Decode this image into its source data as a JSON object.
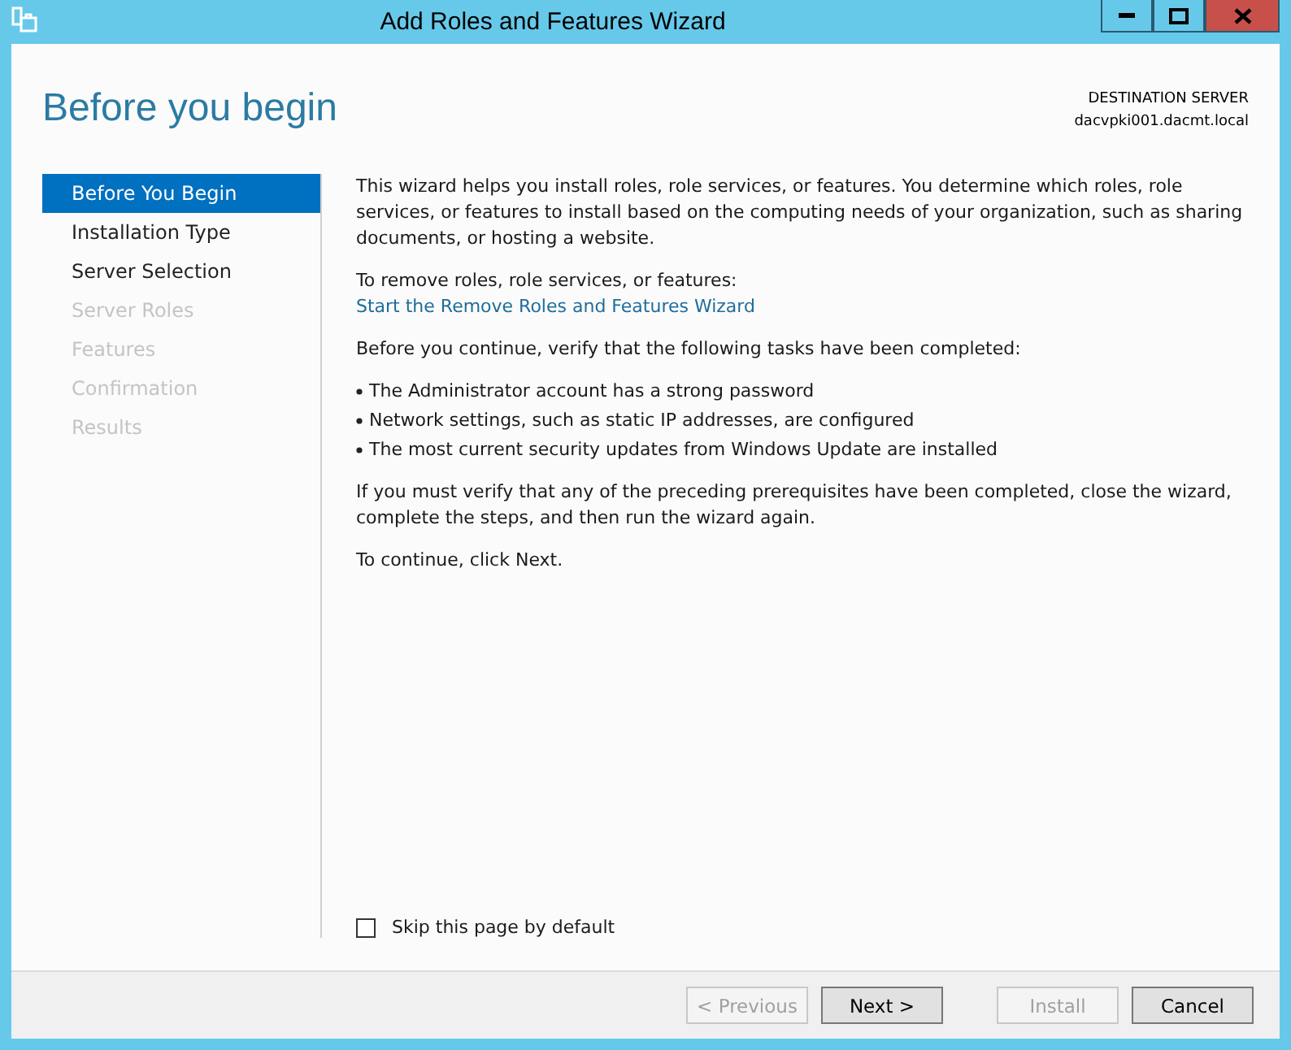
{
  "window": {
    "title": "Add Roles and Features Wizard"
  },
  "page_title": "Before you begin",
  "destination": {
    "label": "DESTINATION SERVER",
    "server": "dacvpki001.dacmt.local"
  },
  "steps": [
    {
      "label": "Before You Begin",
      "selected": true,
      "disabled": false
    },
    {
      "label": "Installation Type",
      "selected": false,
      "disabled": false
    },
    {
      "label": "Server Selection",
      "selected": false,
      "disabled": false
    },
    {
      "label": "Server Roles",
      "selected": false,
      "disabled": true
    },
    {
      "label": "Features",
      "selected": false,
      "disabled": true
    },
    {
      "label": "Confirmation",
      "selected": false,
      "disabled": true
    },
    {
      "label": "Results",
      "selected": false,
      "disabled": true
    }
  ],
  "intro": "This wizard helps you install roles, role services, or features. You determine which roles, role services, or features to install based on the computing needs of your organization, such as sharing documents, or hosting a website.",
  "remove_label": "To remove roles, role services, or features:",
  "remove_link": "Start the Remove Roles and Features Wizard",
  "verify_text": "Before you continue, verify that the following tasks have been completed:",
  "tasks": [
    "The Administrator account has a strong password",
    "Network settings, such as static IP addresses, are configured",
    "The most current security updates from Windows Update are installed"
  ],
  "prereq_text": "If you must verify that any of the preceding prerequisites have been completed, close the wizard, complete the steps, and then run the wizard again.",
  "continue_text": "To continue, click Next.",
  "skip_checkbox": {
    "label": "Skip this page by default",
    "checked": false
  },
  "buttons": [
    {
      "label": "< Previous",
      "disabled": true
    },
    {
      "label": "Next >",
      "disabled": false
    },
    {
      "label": "Install",
      "disabled": true
    },
    {
      "label": "Cancel",
      "disabled": false
    }
  ]
}
